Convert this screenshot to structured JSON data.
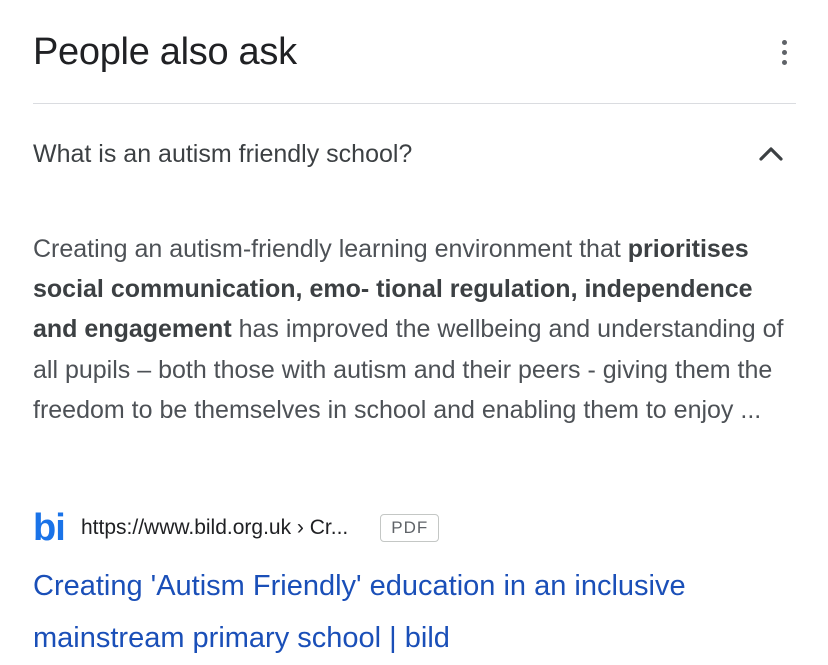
{
  "header": {
    "title": "People also ask",
    "more_icon": "more-vert-icon"
  },
  "question": {
    "text": "What is an autism friendly school?",
    "expanded": true,
    "toggle_icon": "chevron-up-icon"
  },
  "answer": {
    "part1": "Creating an autism-friendly learning environment that ",
    "bold": "prioritises social communication, emo- tional regulation, independence and engagement",
    "part2": " has improved the wellbeing and understanding of all pupils – both those with autism and their peers - giving them the freedom to be themselves in school and enabling them to enjoy ..."
  },
  "source": {
    "logo_text": "bi",
    "url": "https://www.bild.org.uk › Cr...",
    "badge": "PDF"
  },
  "result": {
    "title": "Creating 'Autism Friendly' education in an inclusive mainstream primary school | bild"
  },
  "colors": {
    "link": "#1a4fb8",
    "logo": "#1a73e8",
    "divider": "#dadce0",
    "text": "#202124"
  }
}
